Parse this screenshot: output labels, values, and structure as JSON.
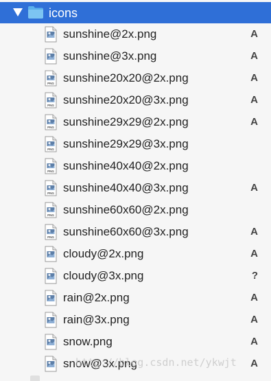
{
  "folder": {
    "name": "icons",
    "icon": "folder-icon",
    "expanded_icon": "disclosure-triangle-down-icon",
    "colors": {
      "selection": "#2f6fd7",
      "folder": "#5ab0ec",
      "text": "#222222"
    }
  },
  "files": [
    {
      "name": "sunshine@2x.png",
      "status": "A",
      "icon": "image-file-icon"
    },
    {
      "name": "sunshine@3x.png",
      "status": "A",
      "icon": "image-file-icon"
    },
    {
      "name": "sunshine20x20@2x.png",
      "status": "A",
      "icon": "png-file-icon"
    },
    {
      "name": "sunshine20x20@3x.png",
      "status": "A",
      "icon": "png-file-icon"
    },
    {
      "name": "sunshine29x29@2x.png",
      "status": "A",
      "icon": "png-file-icon"
    },
    {
      "name": "sunshine29x29@3x.png",
      "status": "",
      "icon": "png-file-icon"
    },
    {
      "name": "sunshine40x40@2x.png",
      "status": "",
      "icon": "png-file-icon"
    },
    {
      "name": "sunshine40x40@3x.png",
      "status": "A",
      "icon": "png-file-icon"
    },
    {
      "name": "sunshine60x60@2x.png",
      "status": "",
      "icon": "png-file-icon"
    },
    {
      "name": "sunshine60x60@3x.png",
      "status": "A",
      "icon": "png-file-icon"
    },
    {
      "name": "cloudy@2x.png",
      "status": "A",
      "icon": "image-file-icon"
    },
    {
      "name": "cloudy@3x.png",
      "status": "?",
      "icon": "image-file-icon"
    },
    {
      "name": "rain@2x.png",
      "status": "A",
      "icon": "image-file-icon"
    },
    {
      "name": "rain@3x.png",
      "status": "A",
      "icon": "image-file-icon"
    },
    {
      "name": "snow.png",
      "status": "A",
      "icon": "image-file-icon"
    },
    {
      "name": "snow@3x.png",
      "status": "A",
      "icon": "image-file-icon"
    }
  ],
  "watermark": "http://blog.csdn.net/ykwjt"
}
